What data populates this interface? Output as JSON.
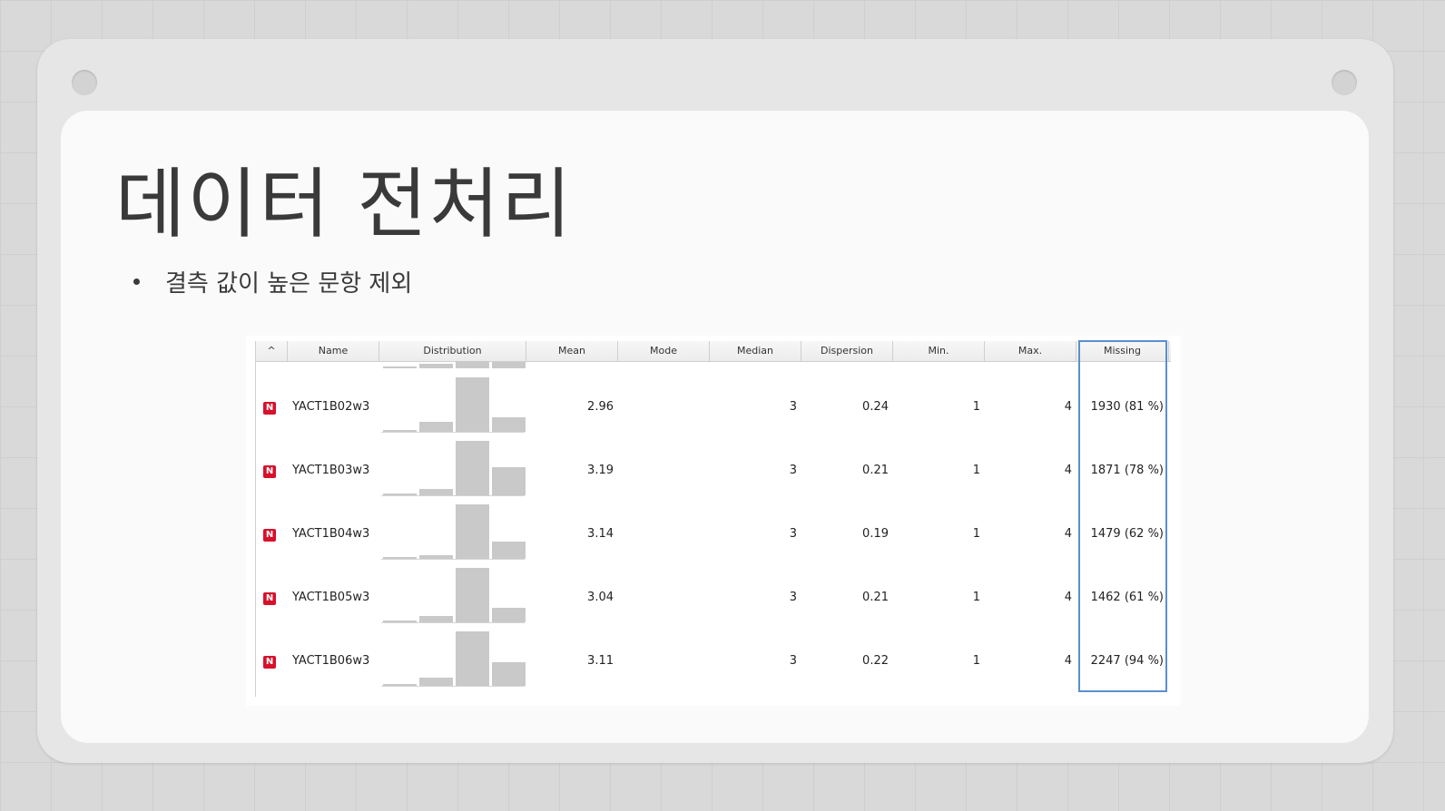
{
  "slide": {
    "title": "데이터 전처리",
    "bullet": "결측 값이 높은 문항 제외"
  },
  "table": {
    "sort_indicator": "^",
    "columns": [
      "",
      "Name",
      "Distribution",
      "Mean",
      "Mode",
      "Median",
      "Dispersion",
      "Min.",
      "Max.",
      "Missing"
    ],
    "highlighted_column": "Missing",
    "row_type_badge": "N",
    "rows": [
      {
        "name": "YACT1B02w3",
        "mean": "2.96",
        "mode": "",
        "median": "3",
        "dispersion": "0.24",
        "min": "1",
        "max": "4",
        "missing": "1930 (81 %)",
        "distribution": [
          0.04,
          0.19,
          1.0,
          0.27
        ]
      },
      {
        "name": "YACT1B03w3",
        "mean": "3.19",
        "mode": "",
        "median": "3",
        "dispersion": "0.21",
        "min": "1",
        "max": "4",
        "missing": "1871 (78 %)",
        "distribution": [
          0.03,
          0.11,
          1.0,
          0.52
        ]
      },
      {
        "name": "YACT1B04w3",
        "mean": "3.14",
        "mode": "",
        "median": "3",
        "dispersion": "0.19",
        "min": "1",
        "max": "4",
        "missing": "1479 (62 %)",
        "distribution": [
          0.03,
          0.06,
          1.0,
          0.32
        ]
      },
      {
        "name": "YACT1B05w3",
        "mean": "3.04",
        "mode": "",
        "median": "3",
        "dispersion": "0.21",
        "min": "1",
        "max": "4",
        "missing": "1462 (61 %)",
        "distribution": [
          0.03,
          0.11,
          1.0,
          0.26
        ]
      },
      {
        "name": "YACT1B06w3",
        "mean": "3.11",
        "mode": "",
        "median": "3",
        "dispersion": "0.22",
        "min": "1",
        "max": "4",
        "missing": "2247 (94 %)",
        "distribution": [
          0.04,
          0.15,
          1.0,
          0.43
        ]
      }
    ]
  }
}
